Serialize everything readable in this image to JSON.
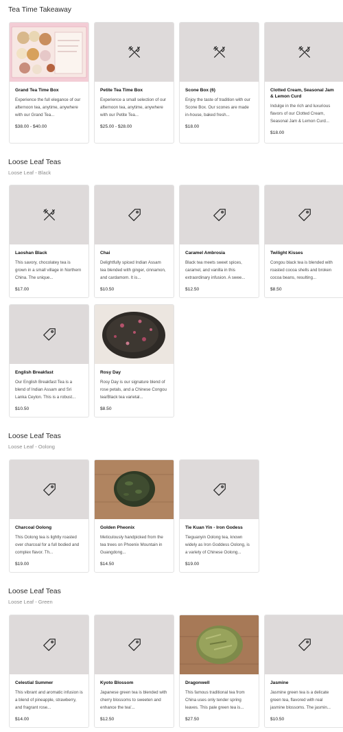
{
  "sections": [
    {
      "title": "Tea Time Takeaway",
      "subtitle": "",
      "items": [
        {
          "name": "Grand Tea Time Box",
          "desc": "Experience the full elegance of our afternoon tea, anytime, anywhere with our Grand Tea...",
          "price": "$38.00 - $40.00",
          "image": "photo",
          "icon": ""
        },
        {
          "name": "Petite Tea Time Box",
          "desc": "Experience a small selection of our afternoon tea, anytime, anywhere with our Petite Tea...",
          "price": "$25.00 - $28.00",
          "image": "placeholder",
          "icon": "fork-knife-icon"
        },
        {
          "name": "Scone Box (6)",
          "desc": "Enjoy the taste of tradition with our Scone Box. Our scones are made in-house, baked fresh...",
          "price": "$18.00",
          "image": "placeholder",
          "icon": "fork-knife-icon"
        },
        {
          "name": "Clotted Cream, Seasonal Jam & Lemon Curd",
          "desc": "Indulge in the rich and luxurious flavors of our Clotted Cream, Seasonal Jam & Lemon Curd...",
          "price": "$18.00",
          "image": "placeholder",
          "icon": "fork-knife-icon"
        }
      ]
    },
    {
      "title": "Loose Leaf Teas",
      "subtitle": "Loose Leaf - Black",
      "items": [
        {
          "name": "Laoshan Black",
          "desc": "This savory, chocolatey tea is grown in a small village in Northern China. The unique...",
          "price": "$17.00",
          "image": "placeholder",
          "icon": "fork-knife-icon"
        },
        {
          "name": "Chai",
          "desc": "Delightfully spiced Indian Assam tea blended with ginger, cinnamon, and cardamom. It is...",
          "price": "$10.50",
          "image": "placeholder",
          "icon": "tag-icon"
        },
        {
          "name": "Caramel Ambrosia",
          "desc": "Black tea meets sweet spices, caramel, and vanilla in this extraordinary infusion. A swee...",
          "price": "$12.50",
          "image": "placeholder",
          "icon": "tag-icon"
        },
        {
          "name": "Twilight Kisses",
          "desc": "Congou black tea is blended with roasted cocoa shells and broken cocoa beans, resulting...",
          "price": "$8.50",
          "image": "placeholder",
          "icon": "tag-icon"
        },
        {
          "name": "English Breakfast",
          "desc": "Our English Breakfast Tea is a blend of Indian Assam and Sri Lanka Ceylon. This is a robust...",
          "price": "$10.50",
          "image": "placeholder",
          "icon": "tag-icon"
        },
        {
          "name": "Rosy Day",
          "desc": "Rosy Day is our signature blend of rose petals, and a Chinese Congou tea/Black tea varietal...",
          "price": "$8.50",
          "image": "photo",
          "icon": ""
        }
      ]
    },
    {
      "title": "Loose Leaf Teas",
      "subtitle": "Loose Leaf - Oolong",
      "items": [
        {
          "name": "Charcoal Oolong",
          "desc": "This Oolong tea is lightly roasted over charcoal for a full bodied and complex flavor. Th...",
          "price": "$19.00",
          "image": "placeholder",
          "icon": "tag-icon"
        },
        {
          "name": "Golden Pheonix",
          "desc": "Meticulously handpicked from the tea trees on Phoenix Mountain in Guangdong...",
          "price": "$14.50",
          "image": "photo",
          "icon": ""
        },
        {
          "name": "Tie Kuan Yin - Iron Godess",
          "desc": "Tieguanyin Oolong tea, known widely as Iron Goddess Oolong, is a variety of Chinese Oolong...",
          "price": "$19.00",
          "image": "placeholder",
          "icon": "tag-icon"
        }
      ]
    },
    {
      "title": "Loose Leaf Teas",
      "subtitle": "Loose Leaf - Green",
      "items": [
        {
          "name": "Celestial Summer",
          "desc": "This vibrant and aromatic infusion is a blend of pineapple, strawberry, and fragrant rose...",
          "price": "$14.00",
          "image": "placeholder",
          "icon": "tag-icon"
        },
        {
          "name": "Kyoto Blossom",
          "desc": "Japanese green tea is blended with cherry blossoms to sweeten and enhance the tea'...",
          "price": "$12.50",
          "image": "placeholder",
          "icon": "tag-icon"
        },
        {
          "name": "Dragonwell",
          "desc": "This famous traditional tea from China uses only tender spring leaves. This pale green tea is...",
          "price": "$27.50",
          "image": "photo",
          "icon": ""
        },
        {
          "name": "Jasmine",
          "desc": "Jasmine green tea is a delicate green tea, flavored with real jasmine blossoms. The jasmin...",
          "price": "$10.50",
          "image": "placeholder",
          "icon": "tag-icon"
        }
      ]
    }
  ],
  "colors": {
    "placeholder_bg": "#dedada",
    "icon_stroke": "#2b2b2b",
    "card_border": "#e2e2e2"
  }
}
